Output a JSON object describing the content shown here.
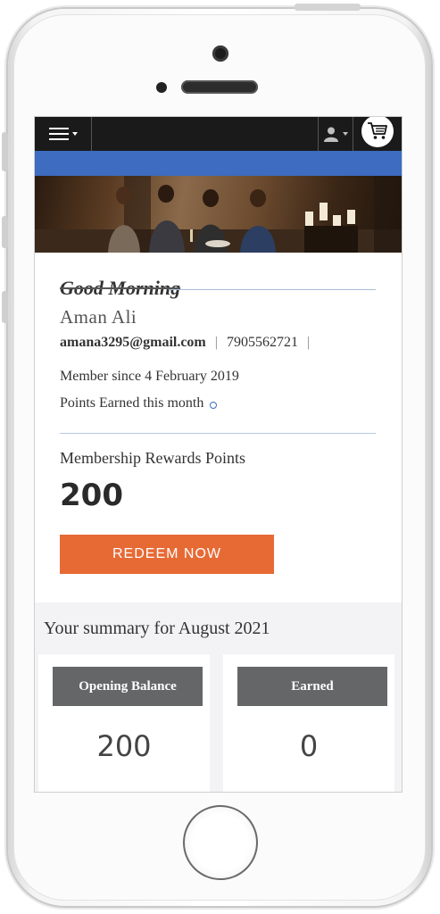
{
  "header": {
    "menu_icon": "hamburger-menu-icon",
    "user_icon": "user-icon",
    "cart_icon": "cart-icon"
  },
  "greeting": "Good Morning",
  "user": {
    "name": "Aman Ali",
    "email": "amana3295@gmail.com",
    "phone": "7905562721",
    "separator": "|",
    "member_since": "Member since 4 February 2019",
    "points_month_label": "Points Earned this month"
  },
  "rewards": {
    "label": "Membership Rewards Points",
    "value": "200",
    "redeem_label": "REDEEM NOW"
  },
  "summary": {
    "title": "Your summary for August 2021",
    "tiles": [
      {
        "label": "Opening Balance",
        "value": "200"
      },
      {
        "label": "Earned",
        "value": "0"
      }
    ]
  },
  "colors": {
    "accent_blue": "#3d6cc0",
    "redeem_orange": "#e76a35",
    "tile_gray": "#656668",
    "topbar": "#1a1a1a"
  }
}
